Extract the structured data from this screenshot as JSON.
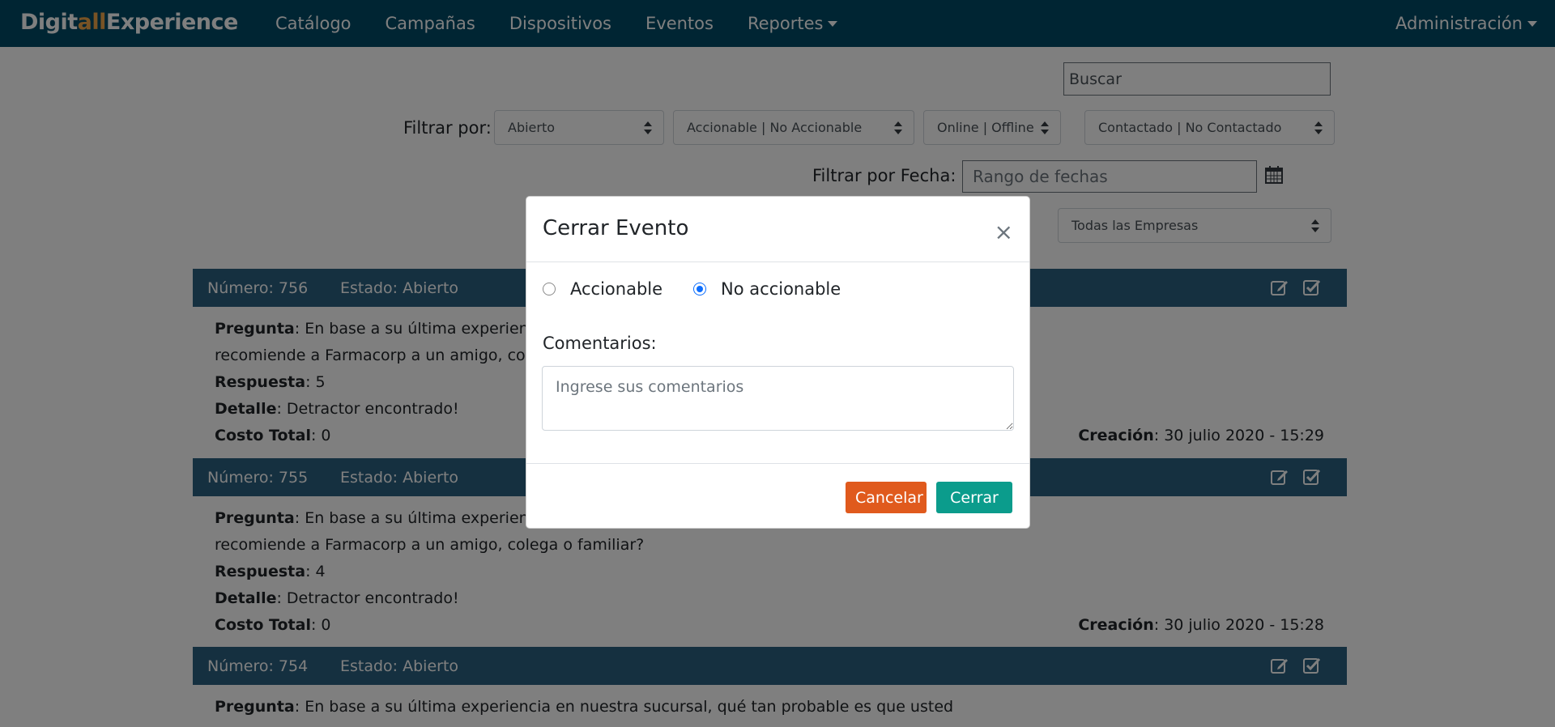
{
  "navbar": {
    "brand_prefix": "Digit",
    "brand_accent": "all",
    "brand_suffix": "Experience",
    "items": [
      {
        "label": "Catálogo"
      },
      {
        "label": "Campañas"
      },
      {
        "label": "Dispositivos"
      },
      {
        "label": "Eventos"
      },
      {
        "label": "Reportes",
        "has_caret": true
      }
    ],
    "admin_label": "Administración",
    "colors": {
      "background": "#004a67",
      "brand_accent": "#f1a64a"
    }
  },
  "filters": {
    "search_placeholder": "Buscar",
    "filter_label": "Filtrar por:",
    "selects": [
      "Abierto",
      "Accionable | No Accionable",
      "Online | Offline",
      "Contactado | No Contactado"
    ],
    "date_label": "Filtrar por Fecha:",
    "date_placeholder": "Rango de fechas",
    "company_select": "Todas las Empresas"
  },
  "events": [
    {
      "number": "Número: 756",
      "state": "Estado: Abierto",
      "question_label": "Pregunta",
      "question_line1": ": En base a su última experiencia en nuestra sucursal, qué tan probable es que usted",
      "question_line2": "recomiende a Farmacorp a un amigo, colega o familiar?",
      "answer_label": "Respuesta",
      "answer": ": 5",
      "detail_label": "Detalle",
      "detail": ": Detractor encontrado!",
      "cost_label": "Costo Total",
      "cost": ": 0",
      "creation_label": "Creación",
      "creation": ": 30 julio 2020 - 15:29"
    },
    {
      "number": "Número: 755",
      "state": "Estado: Abierto",
      "question_label": "Pregunta",
      "question_line1": ": En base a su última experiencia en nuestra sucursal, qué tan probable es que usted",
      "question_line2": "recomiende a Farmacorp a un amigo, colega o familiar?",
      "answer_label": "Respuesta",
      "answer": ": 4",
      "detail_label": "Detalle",
      "detail": ": Detractor encontrado!",
      "cost_label": "Costo Total",
      "cost": ": 0",
      "creation_label": "Creación",
      "creation": ": 30 julio 2020 - 15:28"
    },
    {
      "number": "Número: 754",
      "state": "Estado: Abierto",
      "question_label": "Pregunta",
      "question_line1": ": En base a su última experiencia en nuestra sucursal, qué tan probable es que usted"
    }
  ],
  "modal": {
    "title": "Cerrar Evento",
    "close_symbol": "×",
    "radio_options": [
      {
        "label": "Accionable",
        "checked": false
      },
      {
        "label": "No accionable",
        "checked": true
      }
    ],
    "comments_label": "Comentarios:",
    "comments_placeholder": "Ingrese sus comentarios",
    "cancel_label": "Cancelar",
    "close_label": "Cerrar",
    "colors": {
      "cancel": "#e05a1d",
      "close": "#0b9c8c",
      "radio_selected": "#0d6efd"
    }
  },
  "icons": [
    "calendar-icon",
    "edit-icon",
    "check-square-icon",
    "select-arrows-icon",
    "close-icon",
    "caret-down-icon"
  ]
}
